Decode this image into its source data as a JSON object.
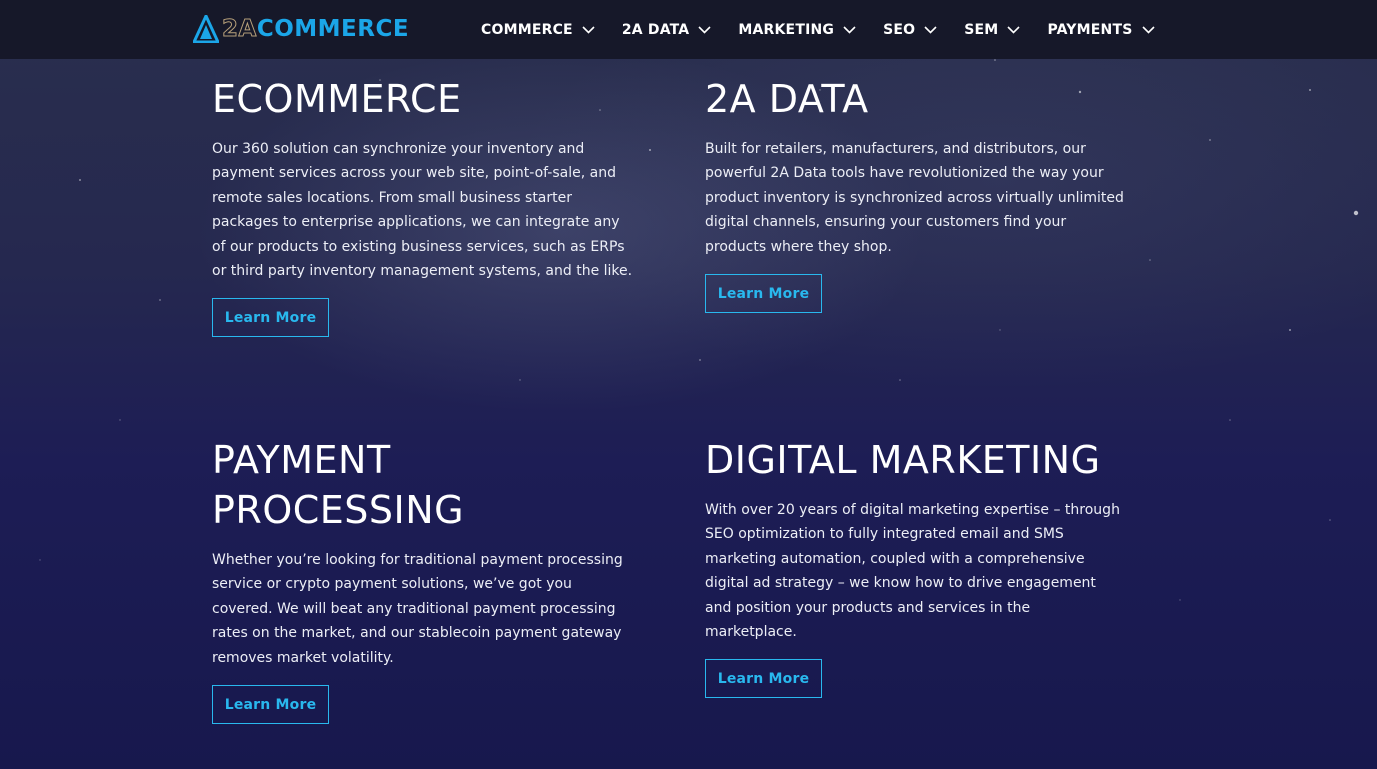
{
  "brand": {
    "prefix": "2A",
    "name": "COMMERCE"
  },
  "nav": {
    "items": [
      {
        "label": "COMMERCE"
      },
      {
        "label": "2A DATA"
      },
      {
        "label": "MARKETING"
      },
      {
        "label": "SEO"
      },
      {
        "label": "SEM"
      },
      {
        "label": "PAYMENTS"
      }
    ]
  },
  "sections": [
    {
      "title": "ECOMMERCE",
      "body": "Our 360 solution can synchronize your inventory and payment services across your web site, point-of-sale, and remote sales locations. From small business starter packages to enterprise applications, we can integrate any of our products to existing business services, such as ERPs or third party inventory management systems, and the like.",
      "button": "Learn More"
    },
    {
      "title": "2A DATA",
      "body": "Built for retailers, manufacturers, and distributors, our powerful 2A Data tools have revolutionized the way your product inventory is synchronized across virtually unlimited digital channels, ensuring your customers find your products where they shop.",
      "button": "Learn More"
    },
    {
      "title": "PAYMENT PROCESSING",
      "body": "Whether you’re looking for traditional payment processing service or crypto payment solutions, we’ve got you covered. We will beat any traditional payment processing rates on the market, and our stablecoin payment gateway removes market volatility.",
      "button": "Learn More"
    },
    {
      "title": "DIGITAL MARKETING",
      "body": "With over 20 years of digital marketing expertise – through SEO optimization to fully integrated email and SMS marketing automation, coupled with a comprehensive digital ad strategy – we know how to drive engagement and position your products and services in the marketplace.",
      "button": "Learn More"
    }
  ],
  "colors": {
    "accent": "#29b8ee",
    "nav_bg": "#161829",
    "logo_gold": "#b7a07a",
    "logo_blue": "#1ba6e8"
  }
}
